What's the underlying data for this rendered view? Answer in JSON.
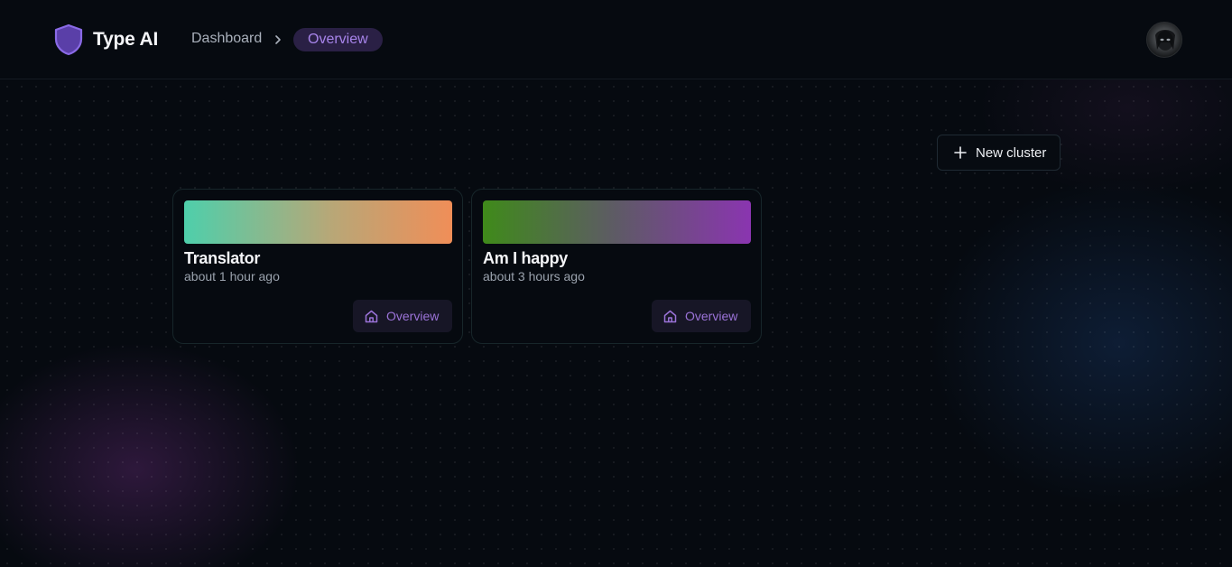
{
  "brand": {
    "name": "Type AI",
    "icon": "shield-icon",
    "accent": "#7b5bd6"
  },
  "breadcrumb": {
    "items": [
      "Dashboard",
      "Overview"
    ],
    "separator_icon": "chevron-right-icon"
  },
  "user": {
    "avatar_icon": "avatar"
  },
  "toolbar": {
    "new_cluster_label": "New cluster",
    "new_cluster_icon": "plus-icon"
  },
  "clusters": [
    {
      "name": "Translator",
      "time": "about 1 hour ago",
      "action_label": "Overview",
      "action_icon": "home-icon",
      "gradient": [
        "#4ecfab",
        "#b8a777",
        "#f08e58"
      ]
    },
    {
      "name": "Am I happy",
      "time": "about 3 hours ago",
      "action_label": "Overview",
      "action_icon": "home-icon",
      "gradient": [
        "#3f8a1a",
        "#5e5a66",
        "#8a35b0"
      ]
    }
  ]
}
